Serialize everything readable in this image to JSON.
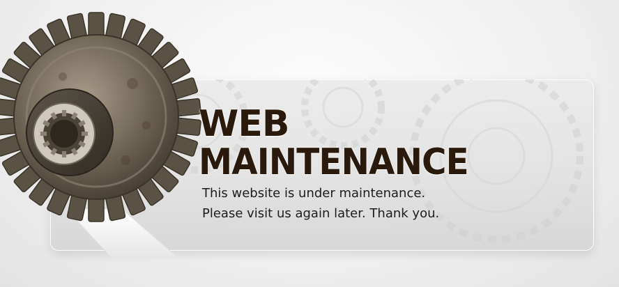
{
  "heading": {
    "line1": "WEB",
    "line2": "MAINTENANCE"
  },
  "message": {
    "line1": "This website is under maintenance.",
    "line2": "Please visit us again later. Thank you."
  },
  "colors": {
    "heading": "#2a1a0c",
    "message": "#1c1c1c",
    "panel": "#e0e0e0",
    "gear": "#6e6558"
  },
  "images": {
    "gear": "gear-icon"
  }
}
